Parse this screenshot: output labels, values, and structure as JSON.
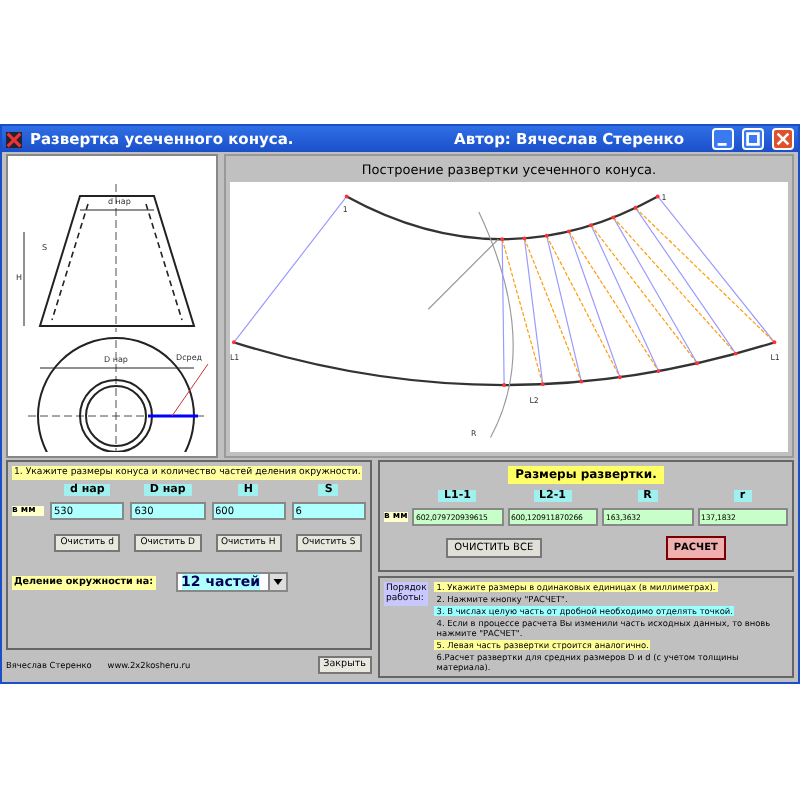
{
  "window": {
    "title": "Развертка усеченного конуса.",
    "author": "Автор: Вячеслав Стеренко"
  },
  "cone_labels": [
    "d нар",
    "H",
    "S",
    "D нар",
    "Dсред"
  ],
  "sketch": {
    "title": "Построение развертки усеченного конуса.",
    "labels": [
      "1",
      "1",
      "L1",
      "L1",
      "L2",
      "R"
    ]
  },
  "inputs": {
    "hint": "1. Укажите размеры конуса и количество частей деления окружности.",
    "unit": "в мм",
    "fields": [
      {
        "label": "d нар",
        "value": "530",
        "clear": "Очистить d"
      },
      {
        "label": "D нар",
        "value": "630",
        "clear": "Очистить D"
      },
      {
        "label": "H",
        "value": "600",
        "clear": "Очистить H"
      },
      {
        "label": "S",
        "value": "6",
        "clear": "Очистить S"
      }
    ],
    "division_label": "Деление окружности на:",
    "division_value": "12 частей"
  },
  "results": {
    "title": "Размеры развертки.",
    "unit": "в мм",
    "fields": [
      {
        "label": "L1-1",
        "value": "602,079720939615"
      },
      {
        "label": "L2-1",
        "value": "600,120911870266"
      },
      {
        "label": "R",
        "value": "163,3632"
      },
      {
        "label": "r",
        "value": "137,1832"
      }
    ],
    "clear_all": "ОЧИСТИТЬ ВСЕ",
    "calculate": "РАСЧЕТ"
  },
  "instructions": {
    "label": "Порядок работы:",
    "steps": [
      {
        "text": "1. Укажите размеры в одинаковых единицах (в миллиметрах).",
        "color": "#ffff99"
      },
      {
        "text": "2. Нажмите кнопку \"РАСЧЕТ\"."
      },
      {
        "text": "3. В числах целую часть от дробной необходимо отделять точкой.",
        "color": "#99ffff"
      },
      {
        "text": "4. Если в процессе расчета Вы изменили часть исходных данных, то вновь нажмите \"РАСЧЕТ\"."
      },
      {
        "text": "5. Левая часть развертки строится аналогично.",
        "color": "#ffff99"
      },
      {
        "text": "6.Расчет развертки для средних размеров D и d (с учетом толщины материала)."
      }
    ]
  },
  "footer": {
    "author": "Вячеслав Стеренко",
    "site": "www.2x2kosheru.ru",
    "close": "Закрыть"
  }
}
